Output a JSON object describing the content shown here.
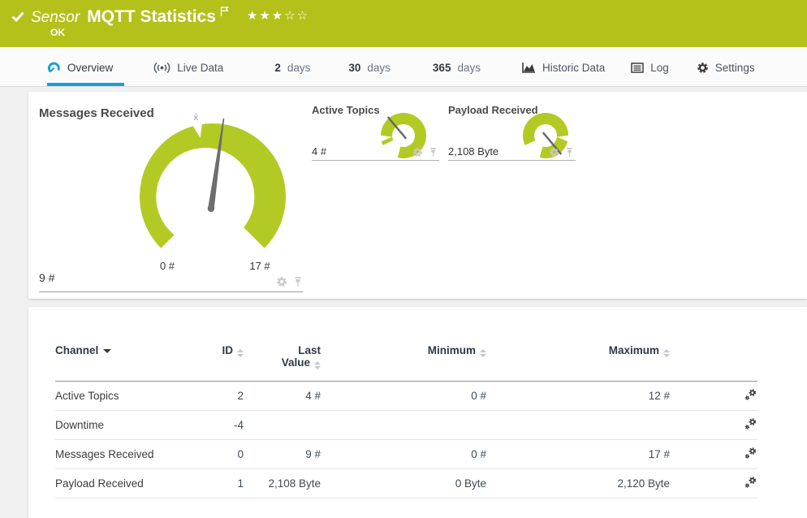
{
  "header": {
    "type_label": "Sensor",
    "title": "MQTT Statistics",
    "status": "OK",
    "stars": "★★★☆☆",
    "color_brand_green": "#b4c11a"
  },
  "tabs": {
    "overview": "Overview",
    "live_data": "Live Data",
    "d2": {
      "num": "2",
      "unit": "days"
    },
    "d30": {
      "num": "30",
      "unit": "days"
    },
    "d365": {
      "num": "365",
      "unit": "days"
    },
    "historic": "Historic Data",
    "log": "Log",
    "settings": "Settings",
    "accent_blue": "#169fd9"
  },
  "gauges": {
    "color_gauge_green": "#b4ca24",
    "primary": {
      "title": "Messages Received",
      "value": "9 #",
      "min_label": "0 #",
      "max_label": "17 #",
      "avg_marker": "x̄"
    },
    "small": [
      {
        "title": "Active Topics",
        "value": "4 #"
      },
      {
        "title": "Payload Received",
        "value": "2,108 Byte"
      }
    ]
  },
  "table": {
    "columns": {
      "channel": "Channel",
      "id": "ID",
      "last_value": "Last Value",
      "minimum": "Minimum",
      "maximum": "Maximum"
    },
    "rows": [
      {
        "channel": "Active Topics",
        "id": "2",
        "last": "4 #",
        "min": "0 #",
        "max": "12 #"
      },
      {
        "channel": "Downtime",
        "id": "-4",
        "last": "",
        "min": "",
        "max": ""
      },
      {
        "channel": "Messages Received",
        "id": "0",
        "last": "9 #",
        "min": "0 #",
        "max": "17 #"
      },
      {
        "channel": "Payload Received",
        "id": "1",
        "last": "2,108 Byte",
        "min": "0 Byte",
        "max": "2,120 Byte"
      }
    ]
  }
}
